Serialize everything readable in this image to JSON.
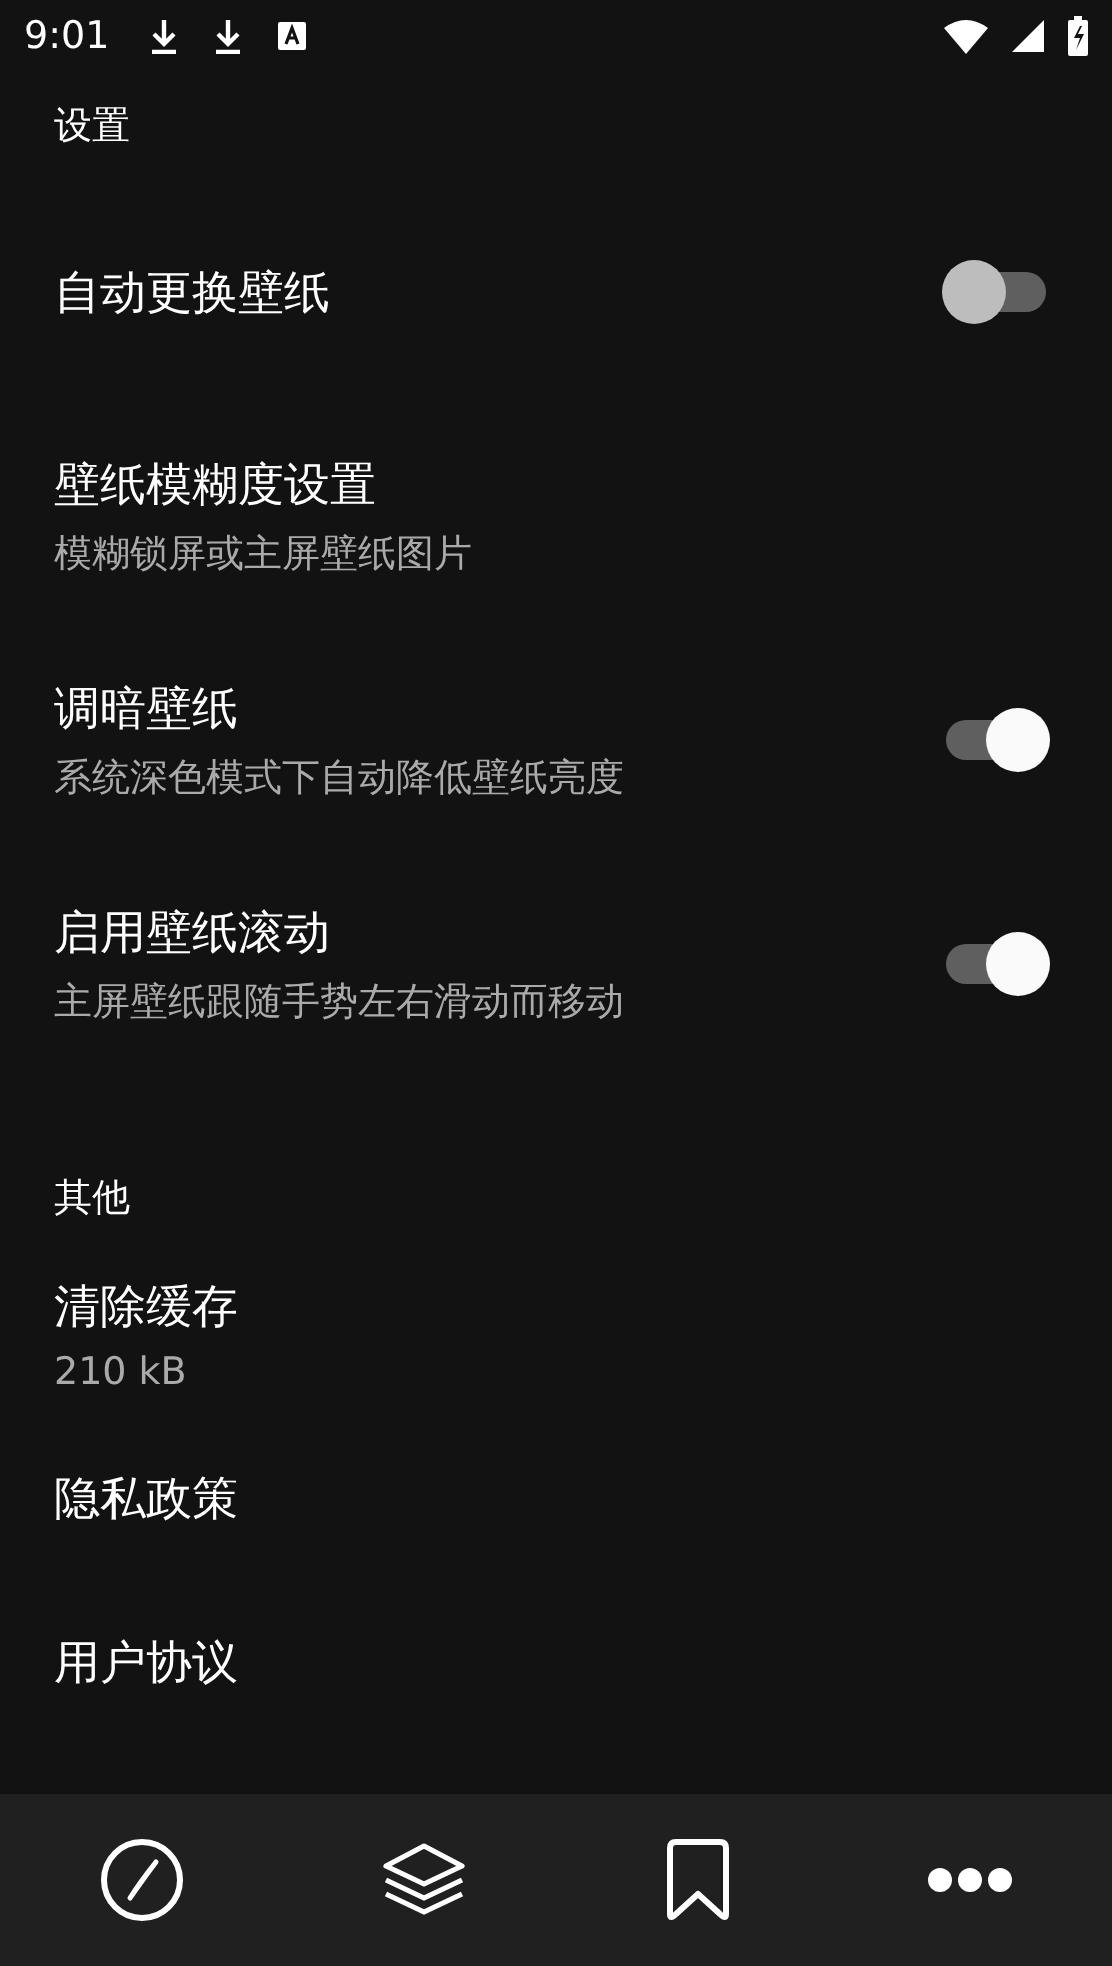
{
  "status_bar": {
    "time": "9:01"
  },
  "sections": [
    {
      "title": "设置",
      "items": [
        {
          "kind": "switch",
          "title": "自动更换壁纸",
          "on": false
        },
        {
          "kind": "link",
          "title": "壁纸模糊度设置",
          "subtitle": "模糊锁屏或主屏壁纸图片"
        },
        {
          "kind": "switch",
          "title": "调暗壁纸",
          "subtitle": "系统深色模式下自动降低壁纸亮度",
          "on": true
        },
        {
          "kind": "switch",
          "title": "启用壁纸滚动",
          "subtitle": "主屏壁纸跟随手势左右滑动而移动",
          "on": true
        }
      ]
    },
    {
      "title": "其他",
      "items": [
        {
          "kind": "link",
          "title": "清除缓存",
          "subtitle": "210 kB"
        },
        {
          "kind": "link",
          "title": "隐私政策"
        },
        {
          "kind": "link",
          "title": "用户协议"
        }
      ]
    }
  ],
  "bottom_nav": [
    {
      "kind": "compass"
    },
    {
      "kind": "layers"
    },
    {
      "kind": "bookmark"
    },
    {
      "kind": "more"
    }
  ]
}
